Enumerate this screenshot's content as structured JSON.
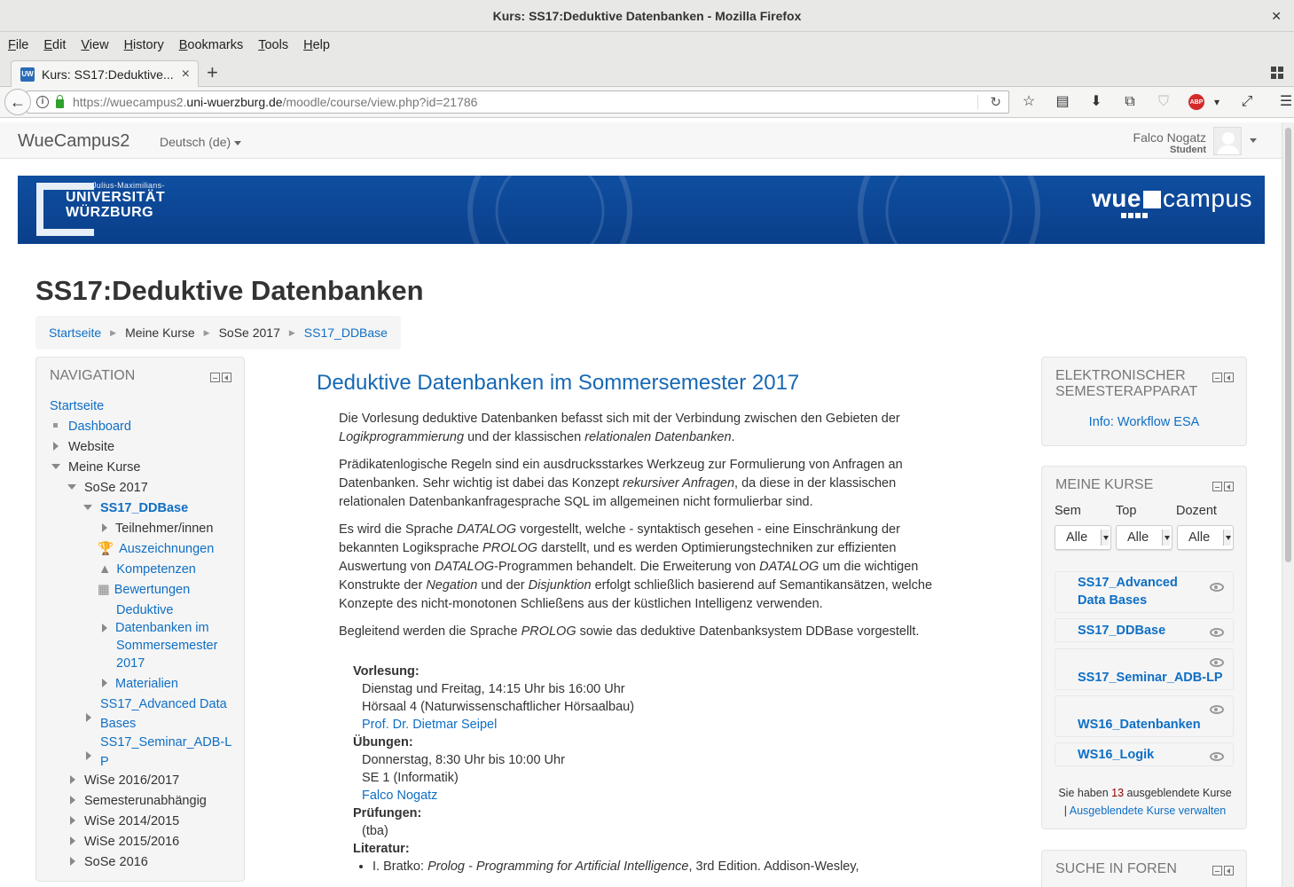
{
  "window": {
    "title": "Kurs: SS17:Deduktive Datenbanken - Mozilla Firefox"
  },
  "menu": [
    "File",
    "Edit",
    "View",
    "History",
    "Bookmarks",
    "Tools",
    "Help"
  ],
  "tab": {
    "label": "Kurs: SS17:Deduktive...",
    "favicon_text": "UW"
  },
  "url": {
    "prefix": "https://wuecampus2.",
    "domain": "uni-wuerzburg.de",
    "path": "/moodle/course/view.php?id=21786"
  },
  "header": {
    "brand": "WueCampus2",
    "language": "Deutsch (de)",
    "user_name": "Falco Nogatz",
    "user_role": "Student"
  },
  "banner": {
    "uni_small": "Julius-Maximilians-",
    "uni_line1": "UNIVERSITÄT",
    "uni_line2": "WÜRZBURG",
    "logo_left": "wue",
    "logo_right": "campus"
  },
  "course_title": "SS17:Deduktive Datenbanken",
  "breadcrumb": [
    "Startseite",
    "Meine Kurse",
    "SoSe 2017",
    "SS17_DDBase"
  ],
  "navigation": {
    "title": "NAVIGATION",
    "items": {
      "startseite": "Startseite",
      "dashboard": "Dashboard",
      "website": "Website",
      "meine_kurse": "Meine Kurse",
      "sose2017": "SoSe 2017",
      "ddbase": "SS17_DDBase",
      "teilnehmer": "Teilnehmer/innen",
      "auszeichnungen": "Auszeichnungen",
      "kompetenzen": "Kompetenzen",
      "bewertungen": "Bewertungen",
      "deduktive_1": "Deduktive",
      "deduktive_2": "Datenbanken im",
      "deduktive_3": "Sommersemester",
      "deduktive_4": "2017",
      "materialien": "Materialien",
      "adv_1": "SS17_Advanced Data",
      "adv_2": "Bases",
      "sem_1": "SS17_Seminar_ADB-L",
      "sem_2": "P",
      "wise1617": "WiSe 2016/2017",
      "semunab": "Semesterunabhängig",
      "wise1415": "WiSe 2014/2015",
      "wise1516": "WiSe 2015/2016",
      "sose2016": "SoSe 2016"
    }
  },
  "main": {
    "section_title": "Deduktive Datenbanken im Sommersemester 2017",
    "p1": [
      "Die Vorlesung deduktive Datenbanken befasst sich mit der Verbindung zwischen den Gebieten der ",
      "Logikprogrammierung",
      " und der klassischen ",
      "relationalen Datenbanken",
      "."
    ],
    "p2": [
      "Prädikatenlogische Regeln sind ein ausdrucksstarkes Werkzeug zur Formulierung von Anfragen an Datenbanken. Sehr wichtig ist dabei das Konzept ",
      "rekursiver Anfragen",
      ", da diese in der klassischen relationalen Datenbankanfragesprache SQL im allgemeinen nicht formulierbar sind."
    ],
    "p3": [
      "Es wird die Sprache ",
      "DATALOG",
      " vorgestellt, welche - syntaktisch gesehen - eine Einschränkung der bekannten Logiksprache ",
      "PROLOG",
      " darstellt, und es werden Optimierungstechniken zur effizienten Auswertung von ",
      "DATALOG",
      "-Programmen behandelt. Die Erweiterung von ",
      "DATALOG",
      " um die wichtigen Konstrukte der ",
      "Negation",
      " und der ",
      "Disjunktion",
      " erfolgt schließlich basierend auf Semantikansätzen, welche Konzepte des nicht-monotonen Schließens aus der küstlichen Intelligenz verwenden."
    ],
    "p4": [
      "Begleitend werden die Sprache ",
      "PROLOG",
      " sowie das deduktive Datenbanksystem DDBase vorgestellt."
    ],
    "vorlesung_label": "Vorlesung:",
    "vorlesung_time": "Dienstag und Freitag, 14:15 Uhr bis 16:00 Uhr",
    "vorlesung_room": "Hörsaal 4 (Naturwissenschaftlicher Hörsaalbau)",
    "vorlesung_prof": "Prof. Dr. Dietmar Seipel",
    "uebungen_label": "Übungen:",
    "uebungen_time": "Donnerstag, 8:30 Uhr bis 10:00 Uhr",
    "uebungen_room": "SE 1 (Informatik)",
    "uebungen_tutor": "Falco Nogatz",
    "pruefungen_label": "Prüfungen:",
    "pruefungen_value": "(tba)",
    "literatur_label": "Literatur:",
    "lit1_a": "I. Bratko: ",
    "lit1_b": "Prolog - Programming for Artificial Intelligence",
    "lit1_c": ", 3rd Edition. Addison-Wesley,"
  },
  "esa": {
    "title_1": "ELEKTRONISCHER",
    "title_2": "SEMESTERAPPARAT",
    "link": "Info: Workflow ESA"
  },
  "meine_kurse": {
    "title": "MEINE KURSE",
    "filters": [
      {
        "label": "Sem",
        "value": "Alle"
      },
      {
        "label": "Top",
        "value": "Alle"
      },
      {
        "label": "Dozent",
        "value": "Alle"
      }
    ],
    "courses": [
      {
        "line1": "SS17_Advanced",
        "line2": "Data Bases"
      },
      {
        "line1": "SS17_DDBase",
        "line2": ""
      },
      {
        "line1": "SS17_Seminar_ADB-LP",
        "line2": ""
      },
      {
        "line1": "WS16_Datenbanken",
        "line2": ""
      },
      {
        "line1": "WS16_Logik",
        "line2": ""
      }
    ],
    "hidden_pre": "Sie haben ",
    "hidden_count": "13",
    "hidden_post": " ausgeblendete Kurse",
    "hidden_link": "Ausgeblendete Kurse verwalten"
  },
  "suche": {
    "title": "SUCHE IN FOREN"
  }
}
